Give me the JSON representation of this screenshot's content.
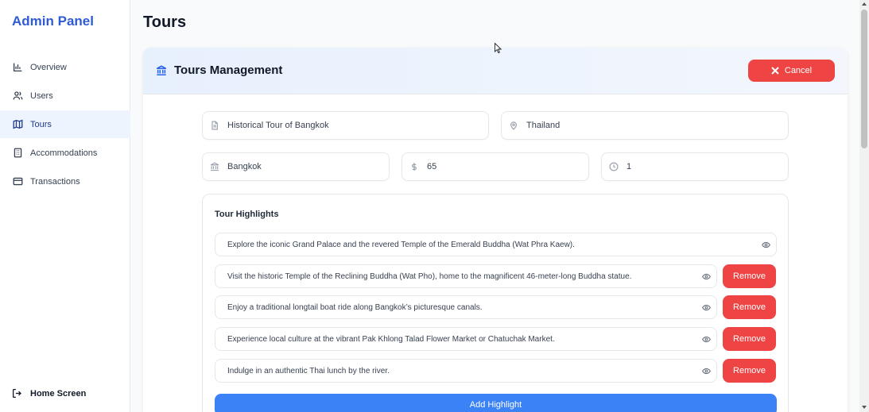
{
  "sidebar": {
    "brand": "Admin Panel",
    "items": [
      {
        "label": "Overview",
        "icon": "bar-chart-icon"
      },
      {
        "label": "Users",
        "icon": "users-icon"
      },
      {
        "label": "Tours",
        "icon": "map-icon",
        "active": true
      },
      {
        "label": "Accommodations",
        "icon": "building-icon"
      },
      {
        "label": "Transactions",
        "icon": "credit-card-icon"
      }
    ],
    "home_label": "Home Screen"
  },
  "page": {
    "title": "Tours"
  },
  "card": {
    "title": "Tours Management",
    "cancel_label": "Cancel",
    "fields": {
      "tour_name": "Historical Tour of Bangkok",
      "country": "Thailand",
      "city": "Bangkok",
      "price": "65",
      "duration": "1"
    },
    "highlights": {
      "title": "Tour Highlights",
      "items": [
        "Explore the iconic Grand Palace and the revered Temple of the Emerald Buddha (Wat Phra Kaew).",
        "Visit the historic Temple of the Reclining Buddha (Wat Pho), home to the magnificent 46-meter-long Buddha statue.",
        "Enjoy a traditional longtail boat ride along Bangkok’s picturesque canals.",
        "Experience local culture at the vibrant Pak Khlong Talad Flower Market or Chatuchak Market.",
        "Indulge in an authentic Thai lunch by the river."
      ],
      "remove_label": "Remove",
      "add_label": "Add Highlight"
    }
  },
  "colors": {
    "brand": "#2f5bd3",
    "danger": "#ef4444",
    "primary": "#3b82f6",
    "active_nav_bg": "#eef4fd"
  }
}
